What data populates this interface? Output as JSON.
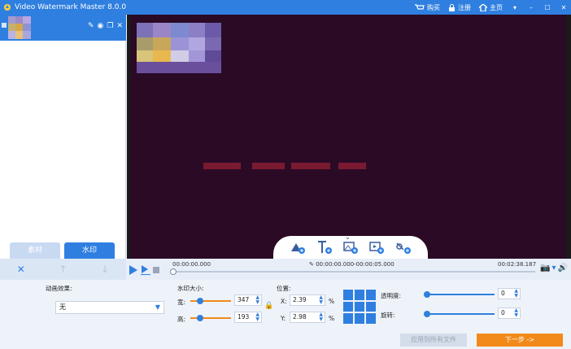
{
  "titlebar": {
    "title": "Video Watermark Master 8.0.0",
    "buy_label": "购买",
    "register_label": "注册",
    "home_label": "主页",
    "icons": [
      "app-logo-icon",
      "cart-icon",
      "lock-icon",
      "home-icon",
      "dropdown-icon",
      "minimize-icon",
      "maximize-icon",
      "close-icon"
    ]
  },
  "left_panel": {
    "tabs": [
      {
        "label": "素材",
        "active": false
      },
      {
        "label": "水印",
        "active": true
      }
    ],
    "tools": {
      "delete": "✕",
      "up": "↑",
      "down": "↓"
    },
    "item_actions": [
      "edit-icon",
      "eye-icon",
      "copy-icon",
      "close-icon"
    ]
  },
  "timeline": {
    "start_time": "00:00:00.000",
    "range": "00:00:00.000-00:00:05.000",
    "end_time": "00:02:38.187",
    "progress": 0
  },
  "settings": {
    "animation_label": "动画效果:",
    "animation_value": "无",
    "size_label": "水印大小:",
    "width_label": "宽:",
    "width_value": "347",
    "height_label": "高:",
    "height_value": "193",
    "position_label": "位置:",
    "x_label": "X:",
    "x_value": "2.39",
    "y_label": "Y:",
    "y_value": "2.98",
    "percent": "%",
    "opacity_label": "透明度:",
    "opacity_value": "0",
    "rotate_label": "旋转:",
    "rotate_value": "0",
    "apply_all_label": "应用到所有文件",
    "next_label": "下一步 ->"
  },
  "colors": {
    "accent": "#2f7fe0",
    "orange": "#f28a1a",
    "preview_bg": "#2b0a26"
  }
}
